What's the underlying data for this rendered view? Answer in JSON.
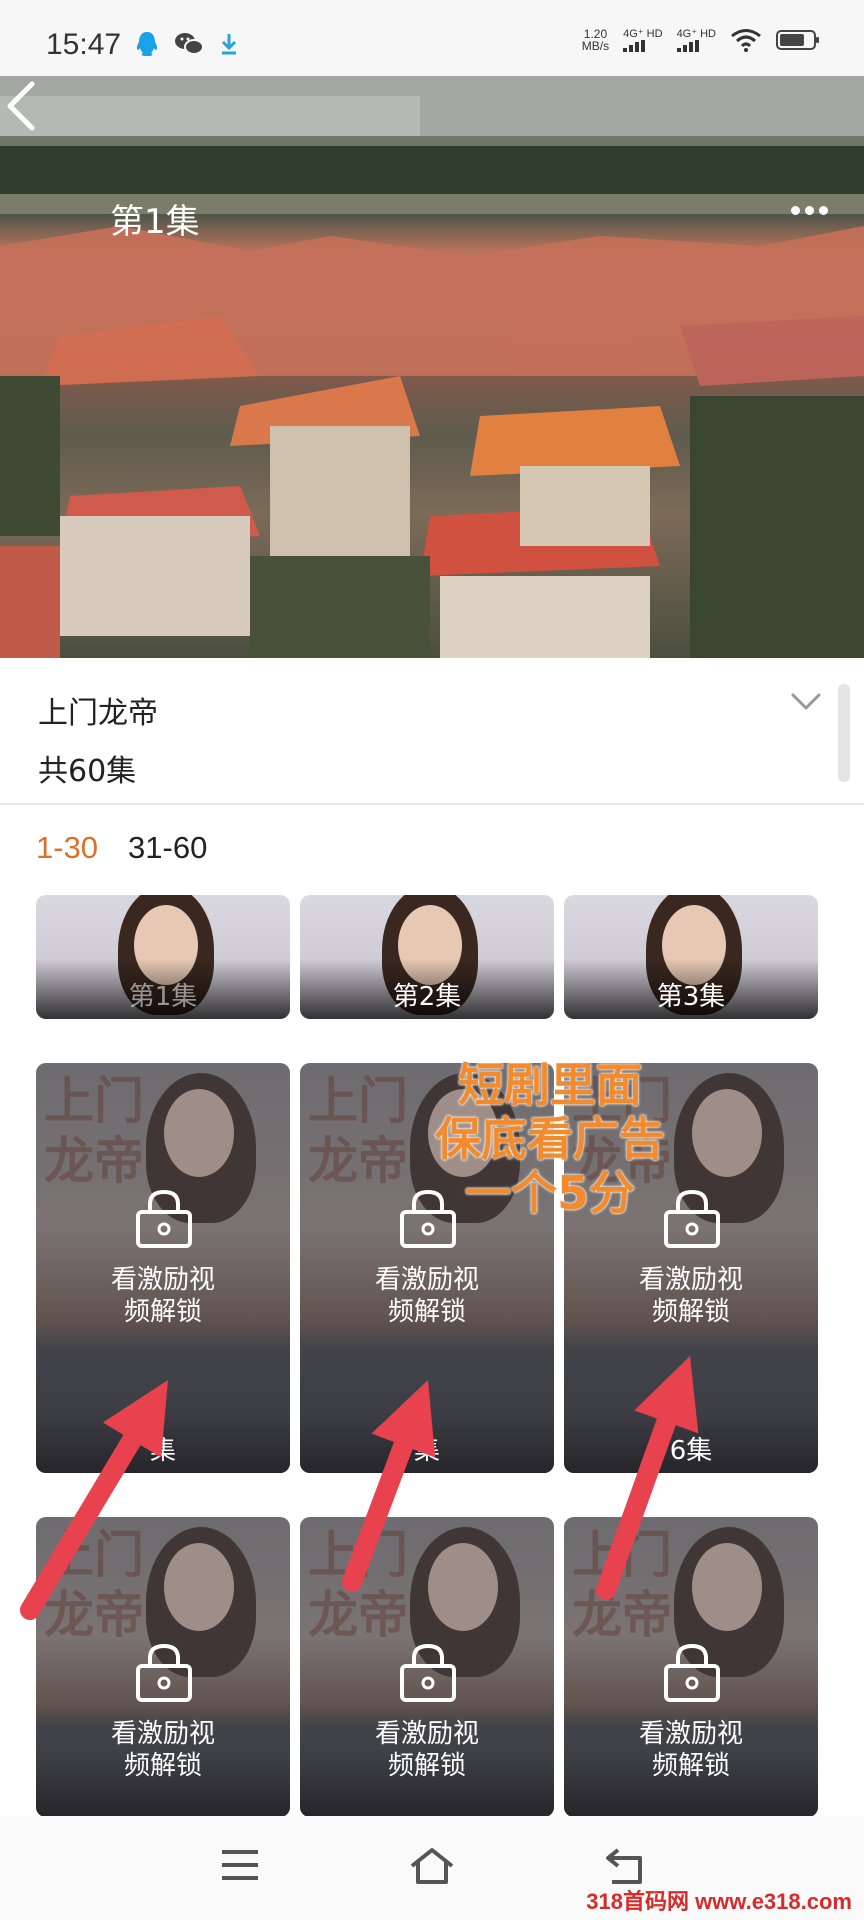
{
  "status_bar": {
    "time": "15:47",
    "net_speed_value": "1.20",
    "net_speed_unit": "MB/s",
    "sim1_label": "4G⁺ HD",
    "sim2_label": "4G⁺ HD",
    "battery_level": 0.75,
    "icons": [
      "qq-icon",
      "wechat-icon",
      "download-icon",
      "wifi-icon",
      "battery-icon"
    ]
  },
  "player": {
    "back_icon": "chevron-left-icon",
    "title": "第1集",
    "more_icon": "more-dots-icon"
  },
  "drama": {
    "title": "上门龙帝",
    "episode_count": "共60集",
    "expand_icon": "chevron-down-icon"
  },
  "range_tabs": [
    {
      "label": "1-30",
      "active": true
    },
    {
      "label": "31-60",
      "active": false
    }
  ],
  "episodes": [
    {
      "label": "第1集",
      "locked": false
    },
    {
      "label": "第2集",
      "locked": false
    },
    {
      "label": "第3集",
      "locked": false
    },
    {
      "label": "集",
      "locked": true,
      "unlock_line1": "看激励视",
      "unlock_line2": "频解锁"
    },
    {
      "label": "集",
      "locked": true,
      "unlock_line1": "看激励视",
      "unlock_line2": "频解锁"
    },
    {
      "label": "6集",
      "locked": true,
      "unlock_line1": "看激励视",
      "unlock_line2": "频解锁"
    },
    {
      "label": "",
      "locked": true,
      "unlock_line1": "看激励视",
      "unlock_line2": "频解锁"
    },
    {
      "label": "",
      "locked": true,
      "unlock_line1": "看激励视",
      "unlock_line2": "频解锁"
    },
    {
      "label": "",
      "locked": true,
      "unlock_line1": "看激励视",
      "unlock_line2": "频解锁"
    }
  ],
  "poster": {
    "title_line1": "上门",
    "title_line2": "龙帝"
  },
  "annotation": {
    "line1": "短剧里面",
    "line2": "保底看广告",
    "line3": "一个5分",
    "color": "#f28a2e",
    "arrow_color": "#e8424f"
  },
  "nav_bar": {
    "icons": [
      "menu-icon",
      "home-icon",
      "back-icon"
    ]
  },
  "watermark": "318首码网 www.e318.com",
  "colors": {
    "accent": "#d9712c",
    "text": "#222222"
  }
}
